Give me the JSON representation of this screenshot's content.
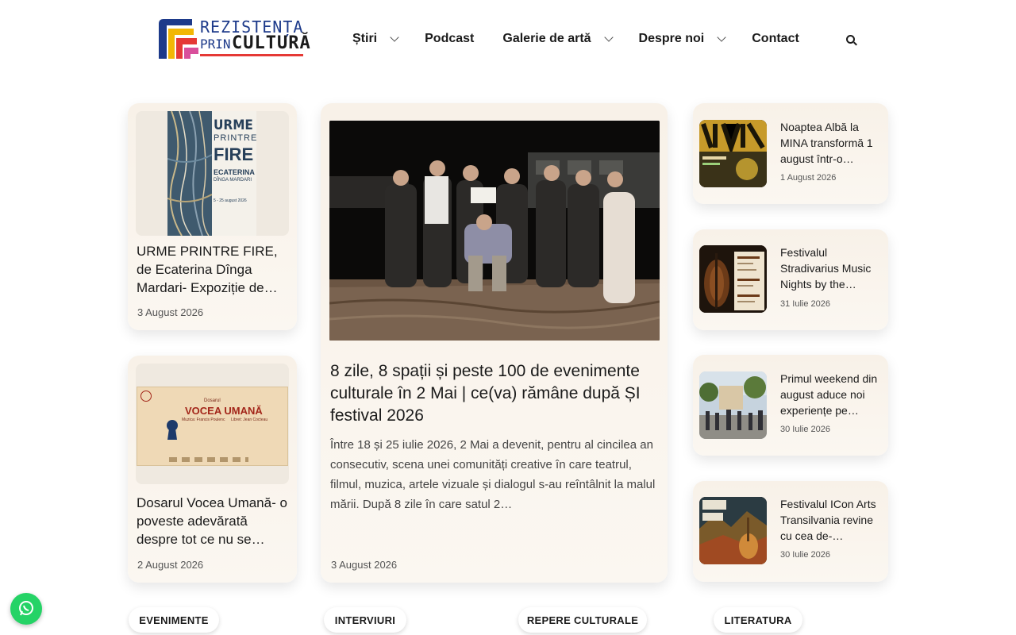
{
  "site": {
    "logo_line1": "REZISTENȚA",
    "logo_line2a": "PRIN",
    "logo_line2b": "CULTURĂ"
  },
  "nav": {
    "items": [
      {
        "label": "Știri",
        "has_dropdown": true
      },
      {
        "label": "Podcast",
        "has_dropdown": false
      },
      {
        "label": "Galerie de artă",
        "has_dropdown": true
      },
      {
        "label": "Despre noi",
        "has_dropdown": true
      },
      {
        "label": "Contact",
        "has_dropdown": false
      }
    ],
    "search_icon": "search-icon"
  },
  "left_cards": [
    {
      "title": "URME PRINTRE FIRE, de Ecaterina Dînga Mardari- Expoziție de…",
      "date": "3 August 2026",
      "image_text": [
        "URME",
        "PRINTRE",
        "FIRE",
        "ECATERINA",
        "DÎNGA MARDARI",
        "5 - 25 august 2026"
      ]
    },
    {
      "title": "Dosarul Vocea Umană- o poveste adevărată despre tot ce nu se…",
      "date": "2 August 2026",
      "image_text": [
        "Dosarul",
        "VOCEA UMANĂ",
        "Muzica: Francis Poulenc",
        "Libret: Jean Cocteau"
      ]
    }
  ],
  "main_article": {
    "title": "8 zile, 8 spații și peste 100 de evenimente culturale în 2 Mai | ce(va) rămâne după ȘI festival 2026",
    "excerpt": "Între 18 și 25 iulie 2026, 2 Mai a devenit, pentru al cincilea an consecutiv, scena unei comunități creative în care teatrul, filmul, muzica, artele vizuale și dialogul s-au reîntâlnit la malul mării. După 8 zile în care satul 2…",
    "date": "3 August 2026"
  },
  "right_cards": [
    {
      "title": "Noaptea Albă la MINA transformă 1 august într-o…",
      "date": "1 August 2026"
    },
    {
      "title": "Festivalul Stradivarius Music Nights by the…",
      "date": "31 Iulie 2026"
    },
    {
      "title": "Primul weekend din august aduce noi experiențe pe…",
      "date": "30 Iulie 2026"
    },
    {
      "title": "Festivalul ICon Arts Transilvania revine cu cea de-…",
      "date": "30 Iulie 2026"
    }
  ],
  "categories": [
    "EVENIMENTE",
    "INTERVIURI",
    "REPERE CULTURALE",
    "LITERATURA"
  ],
  "colors": {
    "card_bg": "#f8f1e8",
    "accent_red": "#e53935",
    "logo_blue": "#1d3a8a",
    "logo_yellow": "#f2b705",
    "whatsapp": "#25d366"
  }
}
